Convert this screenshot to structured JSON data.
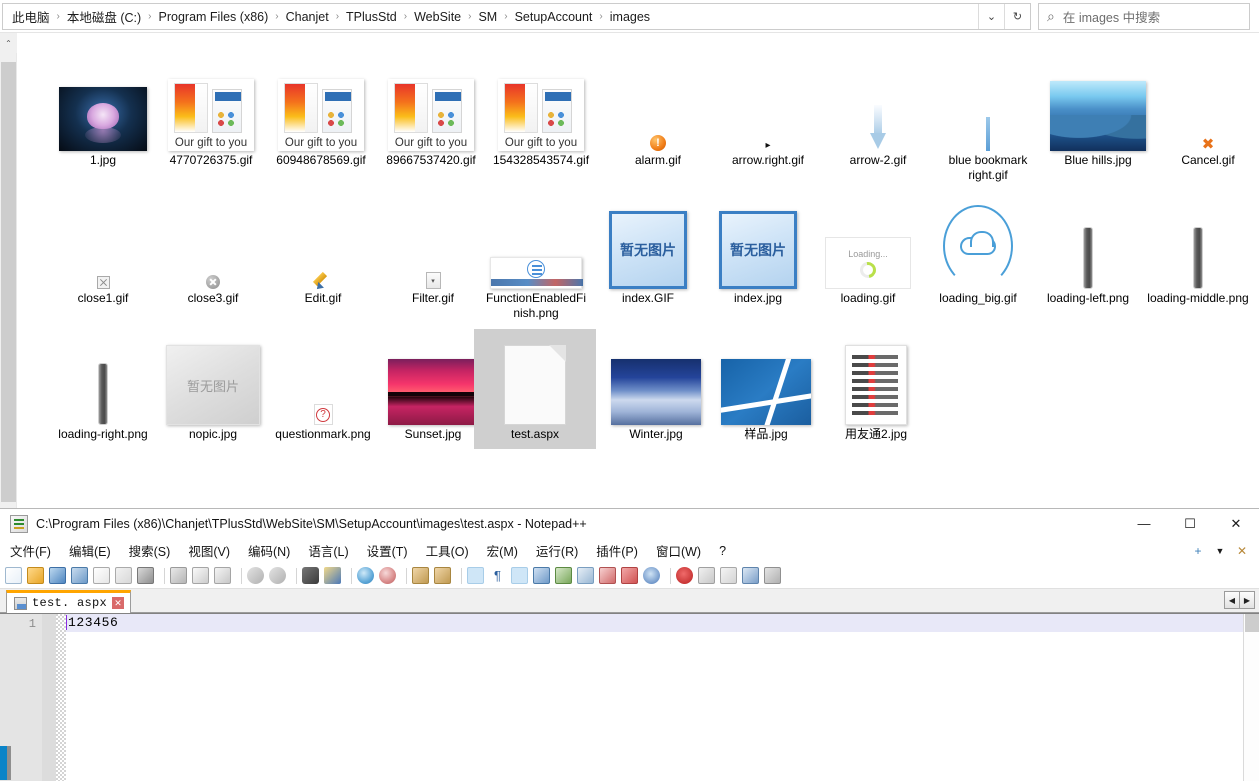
{
  "explorer": {
    "breadcrumb": {
      "name": "address-breadcrumb",
      "items": [
        "此电脑",
        "本地磁盘 (C:)",
        "Program Files (x86)",
        "Chanjet",
        "TPlusStd",
        "WebSite",
        "SM",
        "SetupAccount",
        "images"
      ],
      "separator": "›",
      "dropdown_glyph": "⌄",
      "refresh_glyph": "↻"
    },
    "search": {
      "placeholder": "在 images 中搜索",
      "icon": "search-icon",
      "icon_glyph": "⌕"
    },
    "scrollbar": {
      "up_glyph": "⌃"
    },
    "files": [
      {
        "name": "1.jpg",
        "thumb": "lotus-photo"
      },
      {
        "name": "4770726375.gif",
        "thumb": "gift-banner",
        "caption": "Our gift to you"
      },
      {
        "name": "60948678569.gif",
        "thumb": "gift-banner",
        "caption": "Our gift to you"
      },
      {
        "name": "89667537420.gif",
        "thumb": "gift-banner",
        "caption": "Our gift to you"
      },
      {
        "name": "154328543574.gif",
        "thumb": "gift-banner",
        "caption": "Our gift to you"
      },
      {
        "name": "alarm.gif",
        "thumb": "alarm-icon",
        "glyph": "!"
      },
      {
        "name": "arrow.right.gif",
        "thumb": "arrow-right-icon",
        "glyph": "▸"
      },
      {
        "name": "arrow-2.gif",
        "thumb": "arrow-down-icon"
      },
      {
        "name": "blue bookmark right.gif",
        "thumb": "bookmark-icon"
      },
      {
        "name": "Blue hills.jpg",
        "thumb": "blue-hills-photo"
      },
      {
        "name": "Cancel.gif",
        "thumb": "cancel-icon",
        "glyph": "✖"
      },
      {
        "name": "close1.gif",
        "thumb": "close-box-icon"
      },
      {
        "name": "close3.gif",
        "thumb": "close-circle-icon"
      },
      {
        "name": "Edit.gif",
        "thumb": "pencil-icon"
      },
      {
        "name": "Filter.gif",
        "thumb": "filter-icon"
      },
      {
        "name": "FunctionEnabledFinish.png",
        "thumb": "function-enabled-banner"
      },
      {
        "name": "index.GIF",
        "thumb": "no-picture-placeholder",
        "caption": "暂无图片"
      },
      {
        "name": "index.jpg",
        "thumb": "no-picture-placeholder",
        "caption": "暂无图片"
      },
      {
        "name": "loading.gif",
        "thumb": "loading-small",
        "caption": "Loading..."
      },
      {
        "name": "loading_big.gif",
        "thumb": "loading-cloud"
      },
      {
        "name": "loading-left.png",
        "thumb": "pill-bar"
      },
      {
        "name": "loading-middle.png",
        "thumb": "pill-bar"
      },
      {
        "name": "loading-right.png",
        "thumb": "pill-bar"
      },
      {
        "name": "nopic.jpg",
        "thumb": "no-picture-grey",
        "caption": "暂无图片"
      },
      {
        "name": "questionmark.png",
        "thumb": "question-mark-icon",
        "glyph": "?"
      },
      {
        "name": "Sunset.jpg",
        "thumb": "sunset-photo"
      },
      {
        "name": "test.aspx",
        "thumb": "generic-document",
        "selected": true
      },
      {
        "name": "Winter.jpg",
        "thumb": "winter-photo"
      },
      {
        "name": "样品.jpg",
        "thumb": "tennis-photo"
      },
      {
        "name": "用友通2.jpg",
        "thumb": "document-list-photo"
      }
    ]
  },
  "notepad": {
    "title": "C:\\Program Files (x86)\\Chanjet\\TPlusStd\\WebSite\\SM\\SetupAccount\\images\\test.aspx - Notepad++",
    "window_buttons": {
      "minimize": "—",
      "maximize": "☐",
      "close": "✕"
    },
    "menu": [
      "文件(F)",
      "编辑(E)",
      "搜索(S)",
      "视图(V)",
      "编码(N)",
      "语言(L)",
      "设置(T)",
      "工具(O)",
      "宏(M)",
      "运行(R)",
      "插件(P)",
      "窗口(W)",
      "?"
    ],
    "menu_right": {
      "plus": "+",
      "dropdown": "▼",
      "close_doc": "✕"
    },
    "tab": {
      "label": "test. aspx",
      "close_glyph": "✕"
    },
    "tab_scroll": {
      "left": "◀",
      "right": "▶"
    },
    "editor": {
      "line_number": "1",
      "line_text": "123456"
    }
  }
}
